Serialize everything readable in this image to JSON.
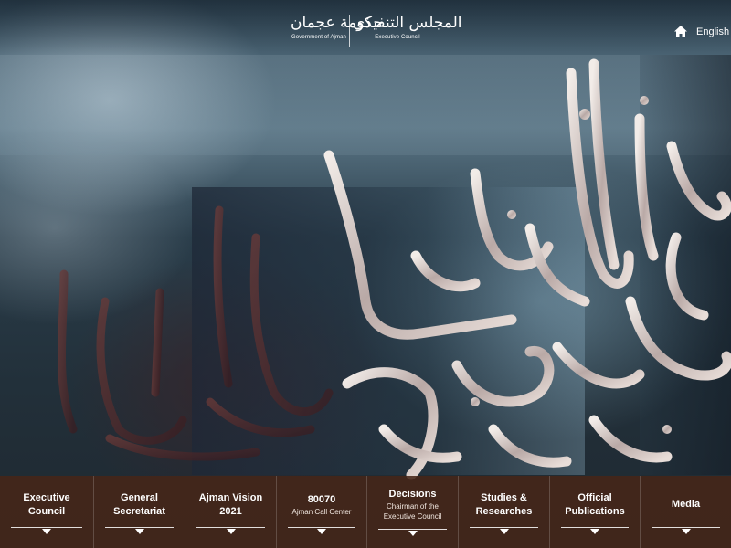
{
  "header": {
    "gov_logo_ar": "حكومة عجمان",
    "gov_logo_en": "Government of Ajman",
    "council_logo_ar": "المجلس التنفيذي",
    "council_logo_en": "Executive Council",
    "home_icon": "home-icon",
    "language_link": "English /"
  },
  "colors": {
    "navbar_bg": "#46261a",
    "text": "#ffffff"
  },
  "nav": {
    "items": [
      {
        "title": "Executive\nCouncil",
        "sub": ""
      },
      {
        "title": "General\nSecretariat",
        "sub": ""
      },
      {
        "title": "Ajman Vision\n2021",
        "sub": ""
      },
      {
        "title": "80070",
        "sub": "Ajman Call Center"
      },
      {
        "title": "Decisions",
        "sub": "Chairman of the\nExecutive Council"
      },
      {
        "title": "Studies &\nResearches",
        "sub": ""
      },
      {
        "title": "Official\nPublications",
        "sub": ""
      },
      {
        "title": "Media",
        "sub": ""
      }
    ]
  }
}
